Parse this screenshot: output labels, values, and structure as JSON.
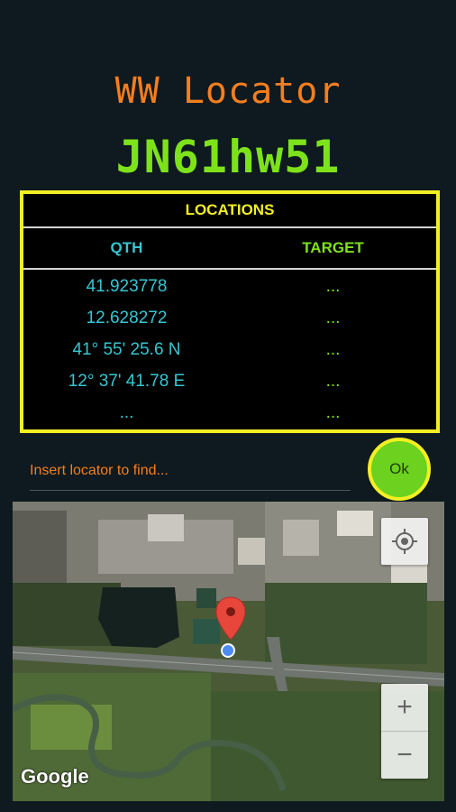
{
  "app": {
    "title": "WW Locator",
    "locator": "JN61hw51"
  },
  "locations": {
    "header": "LOCATIONS",
    "columns": {
      "qth": "QTH",
      "target": "TARGET"
    },
    "rows": [
      {
        "qth": "41.923778",
        "target": "..."
      },
      {
        "qth": "12.628272",
        "target": "..."
      },
      {
        "qth": "41° 55' 25.6 N",
        "target": "..."
      },
      {
        "qth": "12° 37' 41.78 E",
        "target": "..."
      },
      {
        "qth": "...",
        "target": "..."
      }
    ]
  },
  "search": {
    "placeholder": "Insert locator to find...",
    "value": ""
  },
  "ok_button": {
    "label": "Ok"
  },
  "map": {
    "attribution": "Google",
    "zoom_in_label": "+",
    "zoom_out_label": "−",
    "icons": [
      "my-location-icon",
      "map-pin-icon",
      "current-position-dot-icon"
    ]
  },
  "colors": {
    "title": "#f57e1e",
    "locator": "#7ee21b",
    "panel_border": "#f4ef22",
    "qth": "#37c6d2",
    "target": "#7ee21b",
    "ok_button": "#6cd11f"
  }
}
